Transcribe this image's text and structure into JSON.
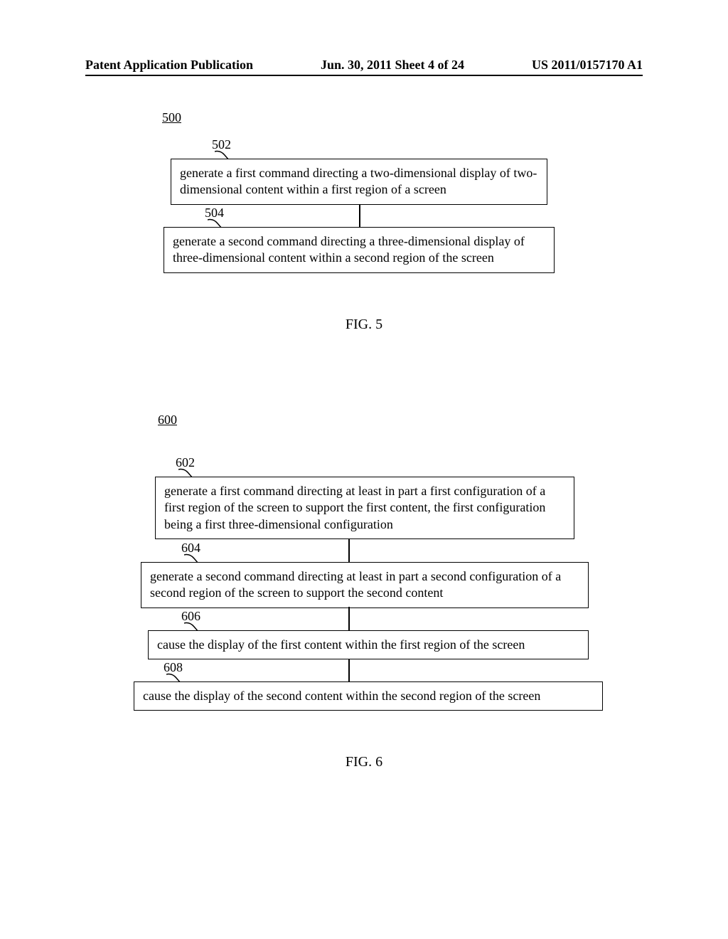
{
  "header": {
    "left": "Patent Application Publication",
    "center": "Jun. 30, 2011  Sheet 4 of 24",
    "right": "US 2011/0157170 A1"
  },
  "fig5": {
    "refnum": "500",
    "caption": "FIG. 5",
    "steps": [
      {
        "num": "502",
        "text": "generate a first command directing a two-dimensional display of two-dimensional content within a first region of a screen"
      },
      {
        "num": "504",
        "text": "generate a second command directing a three-dimensional display of three-dimensional content within a second region of the screen"
      }
    ]
  },
  "fig6": {
    "refnum": "600",
    "caption": "FIG. 6",
    "steps": [
      {
        "num": "602",
        "text": "generate a first command directing at least in part a first configuration of a first region of the screen to support the first content, the first configuration being a first three-dimensional configuration"
      },
      {
        "num": "604",
        "text": "generate a second command directing at least in part a second configuration of a second region of the screen to support the second content"
      },
      {
        "num": "606",
        "text": "cause the display of the first content within the first region of the screen"
      },
      {
        "num": "608",
        "text": "cause the display of the second content within the second region of the screen"
      }
    ]
  }
}
